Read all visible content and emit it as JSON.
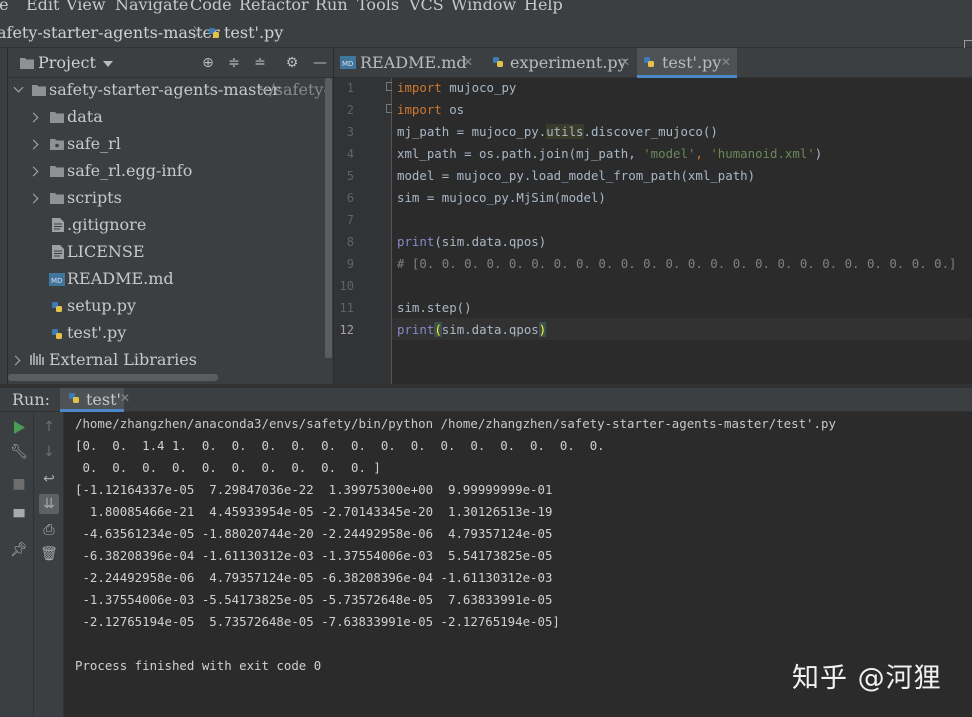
{
  "menu": [
    "le",
    "Edit",
    "View",
    "Navigate",
    "Code",
    "Refactor",
    "Run",
    "Tools",
    "VCS",
    "Window",
    "Help"
  ],
  "breadcrumb": {
    "project": "afety-starter-agents-master",
    "file": "test'.py"
  },
  "project_panel": {
    "title": "Project",
    "tree": [
      {
        "label": "safety-starter-agents-master",
        "sub": "~/safety-st",
        "kind": "root-folder"
      },
      {
        "label": "data",
        "kind": "folder"
      },
      {
        "label": "safe_rl",
        "kind": "package"
      },
      {
        "label": "safe_rl.egg-info",
        "kind": "folder"
      },
      {
        "label": "scripts",
        "kind": "folder"
      },
      {
        "label": ".gitignore",
        "kind": "text"
      },
      {
        "label": "LICENSE",
        "kind": "text"
      },
      {
        "label": "README.md",
        "kind": "md"
      },
      {
        "label": "setup.py",
        "kind": "py"
      },
      {
        "label": "test'.py",
        "kind": "py"
      },
      {
        "label": "External Libraries",
        "kind": "lib"
      }
    ]
  },
  "editor": {
    "tabs": [
      {
        "label": "README.md",
        "active": false
      },
      {
        "label": "experiment.py",
        "active": false
      },
      {
        "label": "test'.py",
        "active": true
      }
    ],
    "line_numbers": [
      "1",
      "2",
      "3",
      "4",
      "5",
      "6",
      "7",
      "8",
      "9",
      "10",
      "11",
      "12"
    ],
    "current_line": "12",
    "comment_line": "# [0. 0. 0. 0. 0. 0. 0. 0. 0. 0. 0. 0. 0. 0. 0. 0. 0. 0. 0. 0. 0. 0. 0. 0.]",
    "code_text": {
      "import": "import",
      "mod_mujoco": " mujoco_py",
      "mod_os": " os",
      "mj_path_a": "mj_path = mujoco_py.",
      "utils": "utils",
      "mj_path_b": ".discover_mujoco()",
      "xml_a": "xml_path = os.path.join(mj_path, ",
      "xml_s1": "'model'",
      "xml_comma": ", ",
      "xml_s2": "'humanoid.xml'",
      "xml_end": ")",
      "model_line": "model = mujoco_py.load_model_from_path(xml_path)",
      "sim_line": "sim = mujoco_py.MjSim(model)",
      "print": "print",
      "print_args": "(sim.data.qpos)",
      "step_line": "sim.step()",
      "open_paren": "(",
      "args_mid": "sim.data.qpos",
      "close_paren": ")"
    }
  },
  "run_panel": {
    "label": "Run:",
    "tab": "test'",
    "output": [
      "/home/zhangzhen/anaconda3/envs/safety/bin/python /home/zhangzhen/safety-starter-agents-master/test'.py",
      "[0.  0.  1.4 1.  0.  0.  0.  0.  0.  0.  0.  0.  0.  0.  0.  0.  0.  0.",
      " 0.  0.  0.  0.  0.  0.  0.  0.  0.  0. ]",
      "[-1.12164337e-05  7.29847036e-22  1.39975300e+00  9.99999999e-01",
      "  1.80085466e-21  4.45933954e-05 -2.70143345e-20  1.30126513e-19",
      " -4.63561234e-05 -1.88020744e-20 -2.24492958e-06  4.79357124e-05",
      " -6.38208396e-04 -1.61130312e-03 -1.37554006e-03  5.54173825e-05",
      " -2.24492958e-06  4.79357124e-05 -6.38208396e-04 -1.61130312e-03",
      " -1.37554006e-03 -5.54173825e-05 -5.73572648e-05  7.63833991e-05",
      " -2.12765194e-05  5.73572648e-05 -7.63833991e-05 -2.12765194e-05]",
      "",
      "Process finished with exit code 0"
    ]
  },
  "watermark": "知乎 @河狸",
  "colors": {
    "keyword": "#cc7832",
    "string": "#6a8759",
    "comment": "#808080",
    "code_text": "#a9b7c6",
    "tab_active_underline": "#4a88c7",
    "run_icon": "#499c54"
  }
}
